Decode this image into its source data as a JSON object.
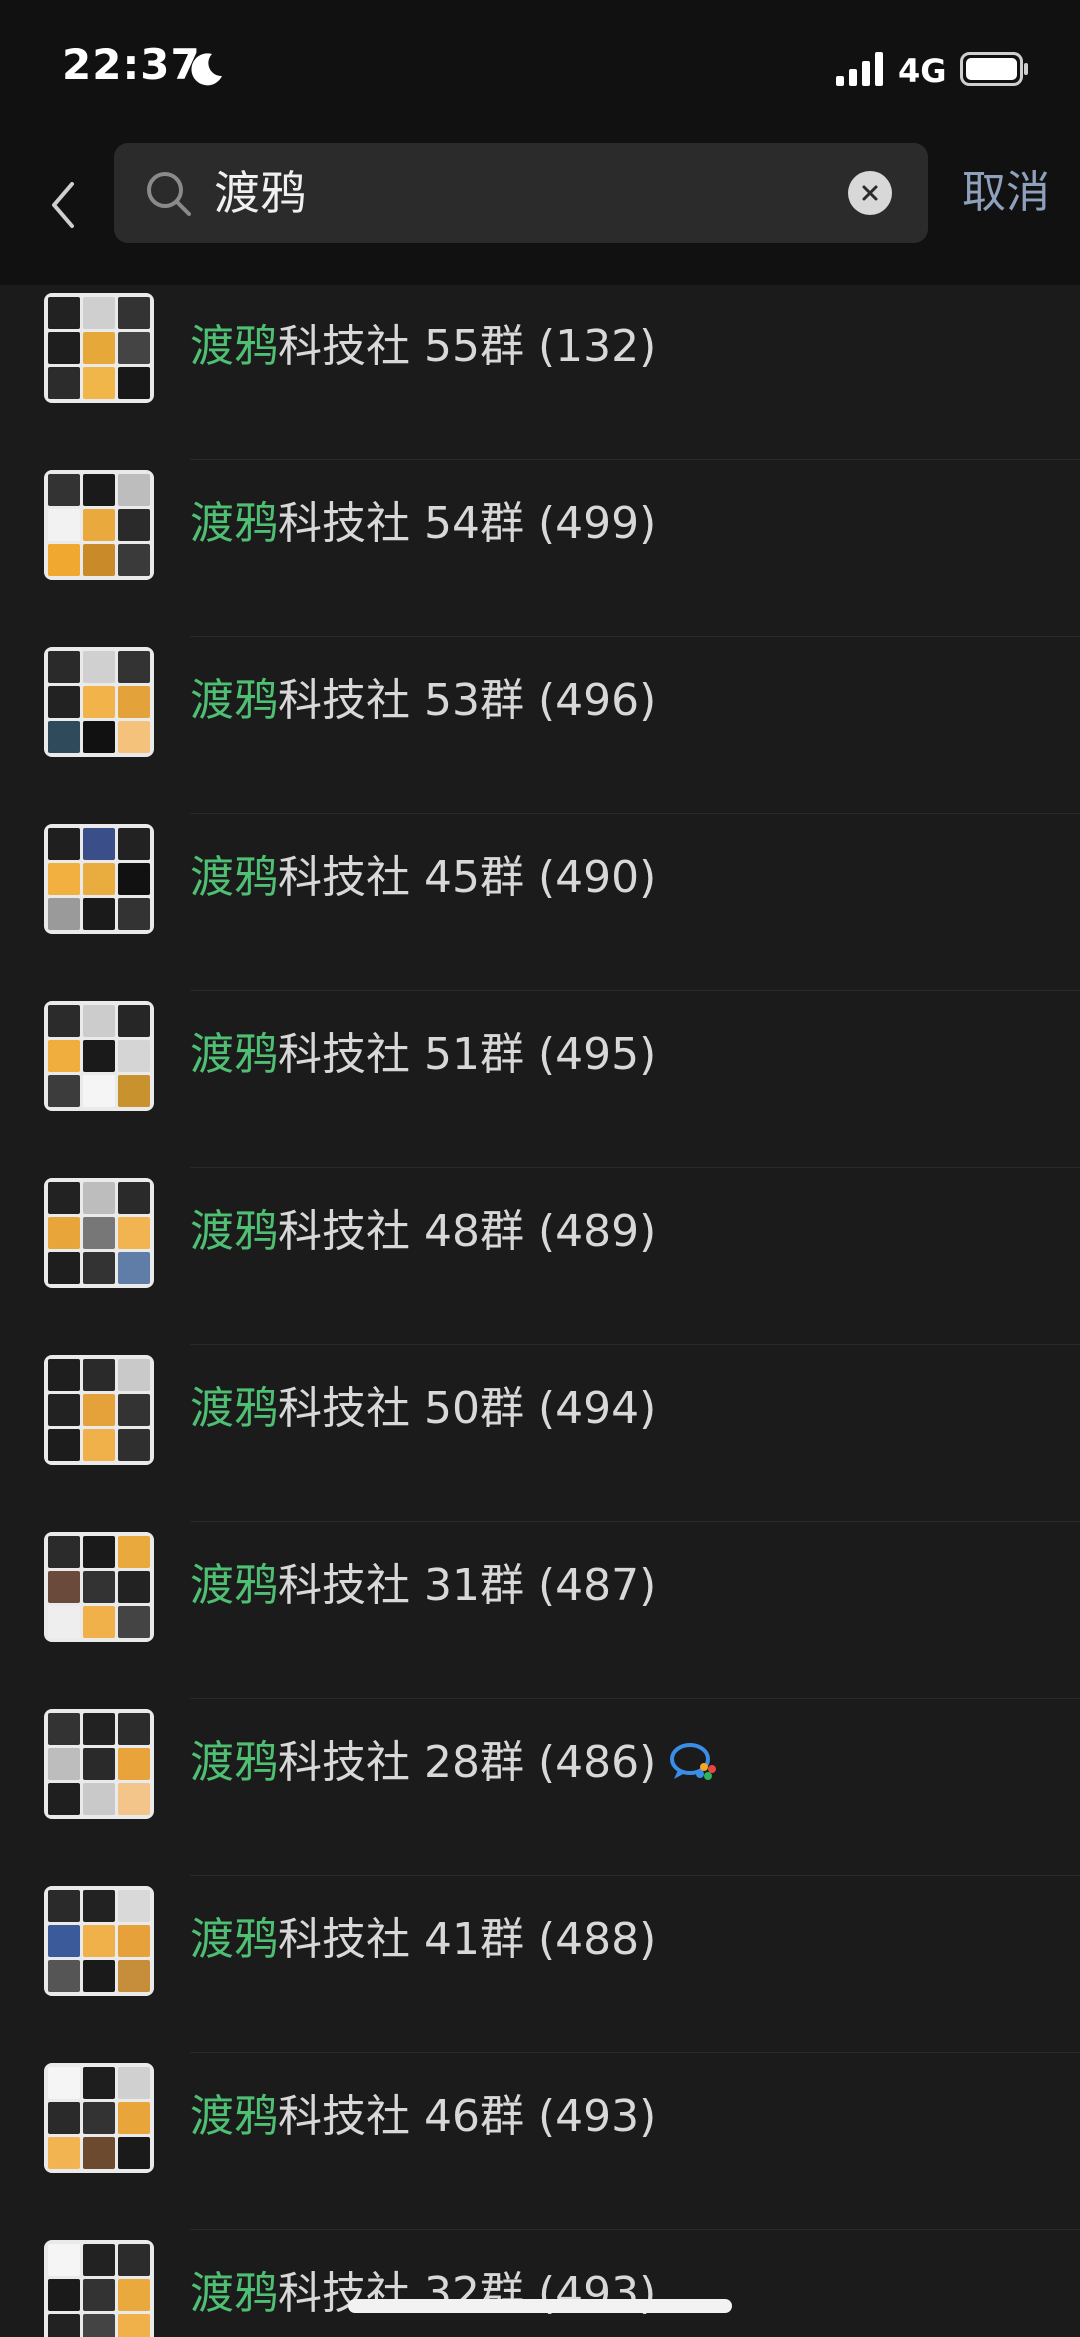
{
  "status_bar": {
    "time": "22:37",
    "network": "4G"
  },
  "search": {
    "query": "渡鸦",
    "cancel_label": "取消"
  },
  "results": [
    {
      "highlight": "渡鸦",
      "rest": "科技社 55群 (132)",
      "badge": false
    },
    {
      "highlight": "渡鸦",
      "rest": "科技社 54群 (499)",
      "badge": false
    },
    {
      "highlight": "渡鸦",
      "rest": "科技社 53群 (496)",
      "badge": false
    },
    {
      "highlight": "渡鸦",
      "rest": "科技社 45群 (490)",
      "badge": false
    },
    {
      "highlight": "渡鸦",
      "rest": "科技社 51群 (495)",
      "badge": false
    },
    {
      "highlight": "渡鸦",
      "rest": "科技社 48群 (489)",
      "badge": false
    },
    {
      "highlight": "渡鸦",
      "rest": "科技社 50群 (494)",
      "badge": false
    },
    {
      "highlight": "渡鸦",
      "rest": "科技社 31群 (487)",
      "badge": false
    },
    {
      "highlight": "渡鸦",
      "rest": "科技社 28群 (486)",
      "badge": true
    },
    {
      "highlight": "渡鸦",
      "rest": "科技社 41群 (488)",
      "badge": false
    },
    {
      "highlight": "渡鸦",
      "rest": "科技社 46群 (493)",
      "badge": false
    },
    {
      "highlight": "渡鸦",
      "rest": "科技社 32群 (493)",
      "badge": false
    }
  ],
  "colors": {
    "highlight": "#4fbf73",
    "cancel": "#8fa0bd",
    "row_background": "#1b1b1b",
    "header_background": "#111111"
  },
  "icons": {
    "status": [
      "moon-icon",
      "signal-icon",
      "battery-icon"
    ],
    "header": [
      "back-chevron-icon",
      "search-icon",
      "clear-icon"
    ],
    "badge": "wecom-icon"
  }
}
